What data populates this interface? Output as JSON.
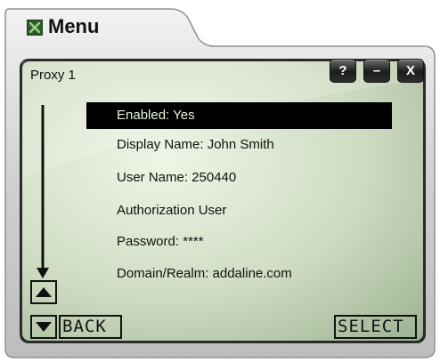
{
  "window": {
    "title": "Menu",
    "help_label": "?",
    "minimize_label": "–",
    "close_label": "X"
  },
  "screen": {
    "title": "Proxy 1",
    "items": [
      {
        "label": "Enabled: Yes",
        "selected": true
      },
      {
        "label": "Display Name: John Smith",
        "selected": false
      },
      {
        "label": "User Name: 250440",
        "selected": false
      },
      {
        "label": "Authorization User",
        "selected": false
      },
      {
        "label": "Password: ****",
        "selected": false
      },
      {
        "label": "Domain/Realm: addaline.com",
        "selected": false
      }
    ]
  },
  "softkeys": {
    "back_label": "BACK",
    "select_label": "SELECT"
  },
  "colors": {
    "frame_grey": "#c9c9c9",
    "screen_green_light": "#e9f1e0",
    "screen_green_dark": "#a9bd9c",
    "selection": "#000000"
  },
  "icons": {
    "title": "menu-app-icon",
    "up": "triangle-up-icon",
    "down": "triangle-down-icon",
    "scroll": "scroll-down-arrow-icon"
  }
}
